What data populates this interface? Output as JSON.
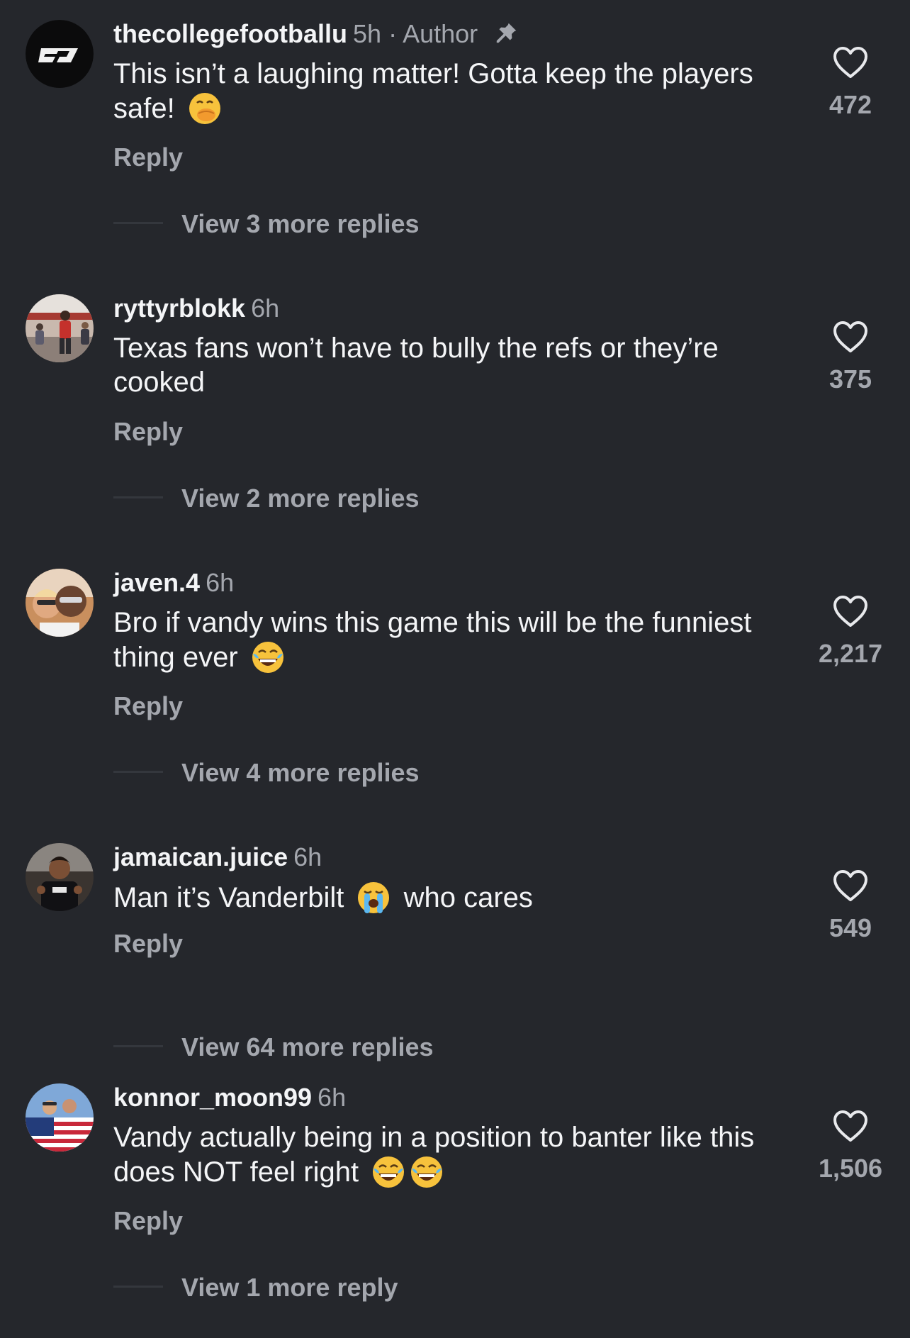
{
  "colors": {
    "background": "#25272c",
    "primary_text": "#f4f5f7",
    "secondary_text": "#a4a7ae"
  },
  "comments": [
    {
      "username": "thecollegefootballu",
      "time": "5h",
      "author_tag": "· Author",
      "pinned": true,
      "text_parts": [
        "This isn’t a laughing matter! Gotta keep the players safe!"
      ],
      "emojis": [
        "face-with-hand-over-mouth"
      ],
      "reply_label": "Reply",
      "view_more_label": "View 3 more replies",
      "likes": "472",
      "avatar": "college-football-logo"
    },
    {
      "username": "ryttyrblokk",
      "time": "6h",
      "text_parts": [
        "Texas fans won’t have to bully the refs or they’re cooked"
      ],
      "emojis": [],
      "reply_label": "Reply",
      "view_more_label": "View 2 more replies",
      "likes": "375",
      "avatar": "user-photo"
    },
    {
      "username": "javen.4",
      "time": "6h",
      "text_parts": [
        "Bro if vandy wins this game this will be the funniest thing ever"
      ],
      "emojis": [
        "face-with-tears-of-joy"
      ],
      "reply_label": "Reply",
      "view_more_label": "View 4 more replies",
      "likes": "2,217",
      "avatar": "user-photo"
    },
    {
      "username": "jamaican.juice",
      "time": "6h",
      "text_parts": [
        "Man it’s Vanderbilt",
        "who cares"
      ],
      "emojis": [
        "loudly-crying-face"
      ],
      "reply_label": "Reply",
      "view_more_label": "View 64 more replies",
      "likes": "549",
      "avatar": "user-photo"
    },
    {
      "username": "konnor_moon99",
      "time": "6h",
      "text_parts": [
        "Vandy actually being in a position to banter like this does NOT feel right"
      ],
      "emojis": [
        "face-with-tears-of-joy",
        "face-with-tears-of-joy"
      ],
      "reply_label": "Reply",
      "view_more_label": "View 1 more reply",
      "likes": "1,506",
      "avatar": "user-photo-flag"
    }
  ]
}
